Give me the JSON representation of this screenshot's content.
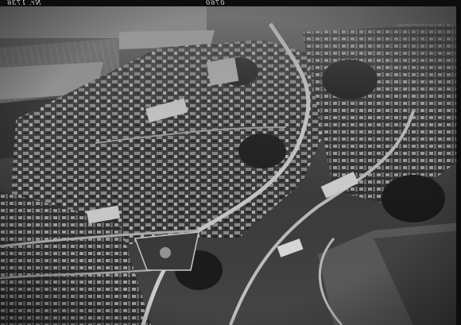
{
  "photo": {
    "kind": "aerial-photograph",
    "tone": "black-and-white",
    "margin_inscriptions": {
      "left": "Nr. 1736",
      "right": "0760"
    }
  }
}
